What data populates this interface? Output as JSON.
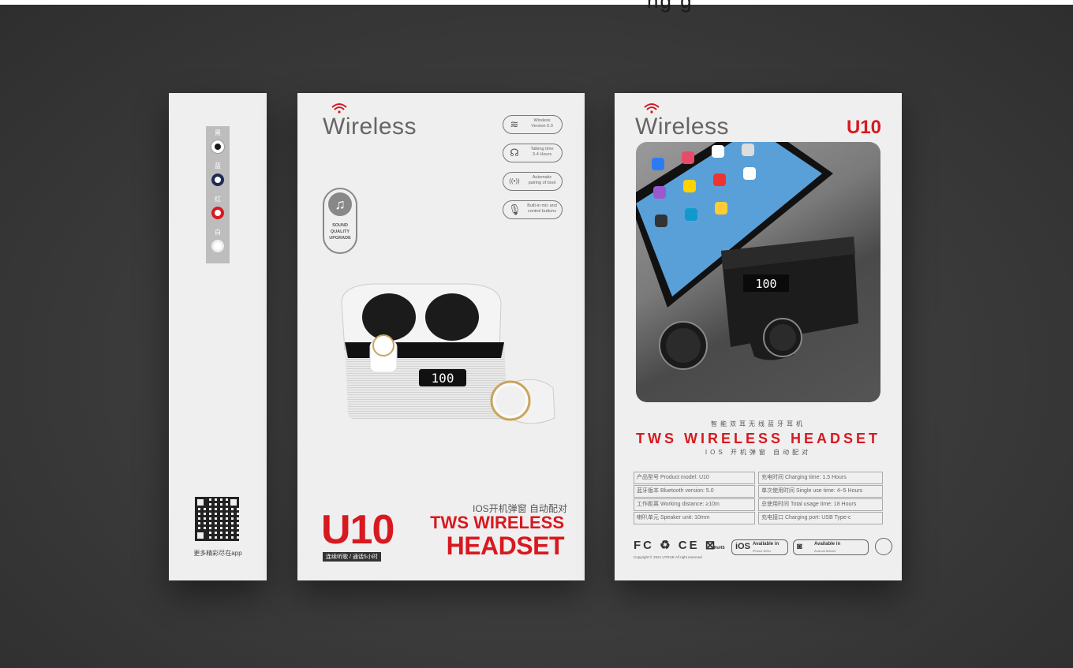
{
  "top_fragment": "ng g",
  "spine": {
    "swatches": [
      {
        "cn": "黑",
        "color": "#1a1a1a"
      },
      {
        "cn": "蓝",
        "color": "#1f2a55"
      },
      {
        "cn": "红",
        "color": "#d71920"
      },
      {
        "cn": "白",
        "color": "#ffffff"
      }
    ],
    "caption": "更多精彩尽在app"
  },
  "front": {
    "brand": "Wireless",
    "features": [
      {
        "icon": "wifi-icon",
        "glyph": "≋",
        "lines": [
          "Wireless",
          "Version 5.0"
        ]
      },
      {
        "icon": "talking-icon",
        "glyph": "☊",
        "lines": [
          "Talking time",
          "3-4 Hours"
        ]
      },
      {
        "icon": "pairing-icon",
        "glyph": "((•))",
        "lines": [
          "Automatic",
          "pairing of boot"
        ]
      },
      {
        "icon": "mic-icon",
        "glyph": "🎙",
        "lines": [
          "Built-in mic and",
          "control buttons"
        ]
      }
    ],
    "sound_badge": [
      "SOUND",
      "QUALITY",
      "UPGRADE"
    ],
    "case_display": "100",
    "ios_line": "IOS开机弹窗 自动配对",
    "model": "U10",
    "model_sub": "连续听歌 / 通话5小时",
    "tws_line1": "TWS WIRELESS",
    "tws_line2": "HEADSET"
  },
  "back": {
    "brand": "Wireless",
    "model": "U10",
    "case_display": "100",
    "cn_title": "智能双耳无线蓝牙耳机",
    "tws": "TWS WIRELESS HEADSET",
    "cn_sub": "IOS 开机弹窗  自动配对",
    "specs": [
      "产品型号 Product model: U10",
      "充电时间 Charging time: 1.5 Hours",
      "蓝牙版本 Bluetooth version: 5.0",
      "单次使用时间 Single use time: 4~5 Hours",
      "工作距离 Working distance: ≥10m",
      "总使用时间 Total usage time: 18 Hours",
      "喇叭单元 Speaker unit: 10mm",
      "充电接口 Charging port: USB Type-c"
    ],
    "cert_marks": "FC ♻ CE ⊠",
    "rohs": "RoHS",
    "copyright": "Copyright © 2021 UTRUE All right reserved",
    "store_ios": {
      "mark": "iOS",
      "title": "Available in",
      "sub": "iPhone 8/Ser"
    },
    "store_android": {
      "mark": "◙",
      "title": "Available in",
      "sub": "Android Market"
    }
  }
}
